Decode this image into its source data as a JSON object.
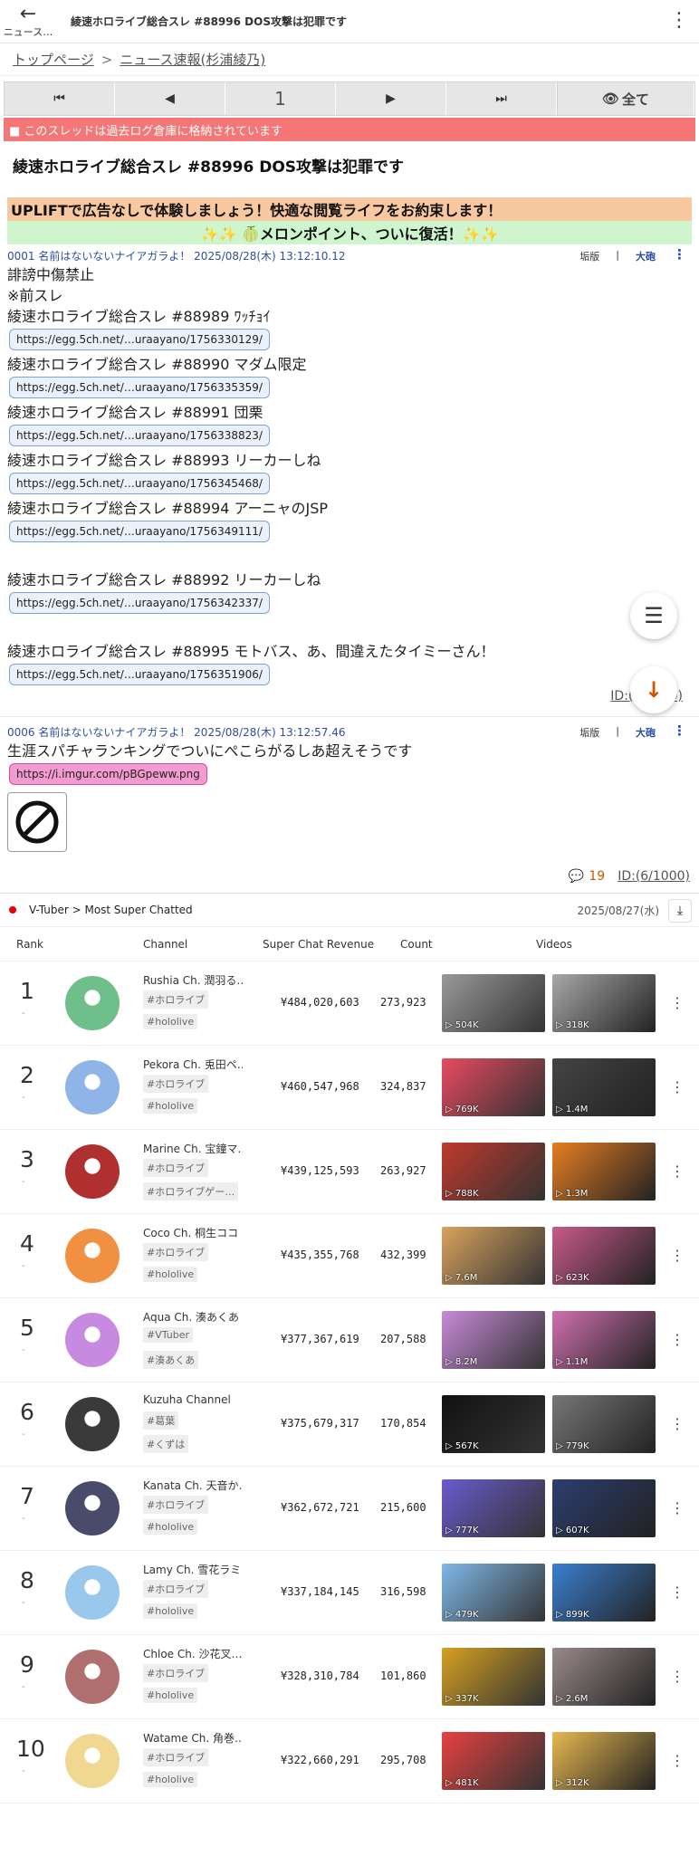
{
  "header": {
    "back_label": "ニュース…",
    "title": "綾速ホロライブ総合スレ #88996 DOS攻撃は犯罪です"
  },
  "breadcrumb": {
    "home": "トップページ",
    "sep": ">",
    "current": "ニュース速報(杉浦綾乃)"
  },
  "pager": {
    "page": "1",
    "all_label": "全て"
  },
  "archived_notice": "■ このスレッドは過去ログ倉庫に格納されています",
  "thread_title": "綾速ホロライブ総合スレ #88996 DOS攻撃は犯罪です",
  "ads": {
    "line1": "UPLIFTで広告なしで体験しましょう！快適な閲覧ライフをお約束します！",
    "line2": "✨✨ 🍈メロンポイント、ついに復活！✨✨"
  },
  "post1": {
    "header": "0001 名前はないないナイアガラよ！ 2025/08/28(木) 13:12:10.12",
    "meta_a": "垢版",
    "meta_sep": "|",
    "meta_b": "大砲",
    "intro1": "誹謗中傷禁止",
    "intro2": "※前スレ",
    "threads": [
      {
        "title": "綾速ホロライブ総合スレ #88989 ﾜｯﾁｮｲ",
        "url": "https://egg.5ch.net/…uraayano/1756330129/"
      },
      {
        "title": "綾速ホロライブ総合スレ #88990 マダム限定",
        "url": "https://egg.5ch.net/…uraayano/1756335359/"
      },
      {
        "title": "綾速ホロライブ総合スレ #88991 団栗",
        "url": "https://egg.5ch.net/…uraayano/1756338823/"
      },
      {
        "title": "綾速ホロライブ総合スレ #88993 リーカーしね",
        "url": "https://egg.5ch.net/…uraayano/1756345468/"
      },
      {
        "title": "綾速ホロライブ総合スレ #88994 アーニャのJSP",
        "url": "https://egg.5ch.net/…uraayano/1756349111/"
      }
    ],
    "extra": [
      {
        "title": "綾速ホロライブ総合スレ #88992 リーカーしね",
        "url": "https://egg.5ch.net/…uraayano/1756342337/"
      },
      {
        "title": "綾速ホロライブ総合スレ #88995 モトバス、あ、間違えたタイミーさん！",
        "url": "https://egg.5ch.net/…uraayano/1756351906/"
      }
    ],
    "id": "ID:(1/1000)"
  },
  "post6": {
    "header": "0006 名前はないないナイアガラよ！ 2025/08/28(木) 13:12:57.46",
    "meta_a": "垢版",
    "meta_sep": "|",
    "meta_b": "大砲",
    "text": "生涯スパチャランキングでついにぺこらがるしあ超えそうです",
    "url": "https://i.imgur.com/pBGpeww.png",
    "reply_count": "19",
    "id": "ID:(6/1000)"
  },
  "ranking": {
    "crumb": "V-Tuber > Most Super Chatted",
    "date": "2025/08/27(水)",
    "columns": {
      "rank": "Rank",
      "channel": "Channel",
      "revenue": "Super Chat Revenue",
      "count": "Count",
      "videos": "Videos"
    },
    "rows": [
      {
        "rank": "1",
        "diff": "-",
        "name": "Rushia Ch. 潤羽る…",
        "tags": [
          "#ホロライブ",
          "#hololive"
        ],
        "revenue": "¥484,020,603",
        "count": "273,923",
        "v1": "504K",
        "v2": "318K",
        "c1": "#999999",
        "c2": "#a8a8a8",
        "av": "#6fbf8a"
      },
      {
        "rank": "2",
        "diff": "-",
        "name": "Pekora Ch. 兎田ペ…",
        "tags": [
          "#ホロライブ",
          "#hololive"
        ],
        "revenue": "¥460,547,968",
        "count": "324,837",
        "v1": "769K",
        "v2": "1.4M",
        "c1": "#e84a5f",
        "c2": "#444444",
        "av": "#8fb4e8"
      },
      {
        "rank": "3",
        "diff": "-",
        "name": "Marine Ch. 宝鐘マ…",
        "tags": [
          "#ホロライブ",
          "#ホロライブゲー…"
        ],
        "revenue": "¥439,125,593",
        "count": "263,927",
        "v1": "788K",
        "v2": "1.3M",
        "c1": "#c0392b",
        "c2": "#e67e22",
        "av": "#b03030"
      },
      {
        "rank": "4",
        "diff": "-",
        "name": "Coco Ch. 桐生ココ",
        "tags": [
          "#ホロライブ",
          "#hololive"
        ],
        "revenue": "¥435,355,768",
        "count": "432,399",
        "v1": "7.6M",
        "v2": "623K",
        "c1": "#d9a25e",
        "c2": "#c85a8a",
        "av": "#f09040"
      },
      {
        "rank": "5",
        "diff": "-",
        "name": "Aqua Ch. 湊あくあ",
        "tags": [
          "#VTuber",
          "#湊あくあ"
        ],
        "revenue": "¥377,367,619",
        "count": "207,588",
        "v1": "8.2M",
        "v2": "1.1M",
        "c1": "#c88ad8",
        "c2": "#d070b0",
        "av": "#c68ae0"
      },
      {
        "rank": "6",
        "diff": "-",
        "name": "Kuzuha Channel",
        "tags": [
          "#葛葉",
          "#くずは"
        ],
        "revenue": "¥375,679,317",
        "count": "170,854",
        "v1": "567K",
        "v2": "779K",
        "c1": "#111111",
        "c2": "#777777",
        "av": "#3a3a3a"
      },
      {
        "rank": "7",
        "diff": "-",
        "name": "Kanata Ch. 天音か…",
        "tags": [
          "#ホロライブ",
          "#hololive"
        ],
        "revenue": "¥362,672,721",
        "count": "215,600",
        "v1": "777K",
        "v2": "607K",
        "c1": "#6a5acd",
        "c2": "#2c3e70",
        "av": "#4a4a6a"
      },
      {
        "rank": "8",
        "diff": "-",
        "name": "Lamy Ch. 雪花ラミィ",
        "tags": [
          "#ホロライブ",
          "#hololive"
        ],
        "revenue": "¥337,184,145",
        "count": "316,598",
        "v1": "479K",
        "v2": "899K",
        "c1": "#7fb8e8",
        "c2": "#3a7fd0",
        "av": "#9ac8ec"
      },
      {
        "rank": "9",
        "diff": "-",
        "name": "Chloe Ch. 沙花叉…",
        "tags": [
          "#ホロライブ",
          "#hololive"
        ],
        "revenue": "¥328,310,784",
        "count": "101,860",
        "v1": "337K",
        "v2": "2.6M",
        "c1": "#d4a020",
        "c2": "#9a8a8a",
        "av": "#b07070"
      },
      {
        "rank": "10",
        "diff": "-",
        "name": "Watame Ch. 角巻…",
        "tags": [
          "#ホロライブ",
          "#hololive"
        ],
        "revenue": "¥322,660,291",
        "count": "295,708",
        "v1": "481K",
        "v2": "312K",
        "c1": "#e84040",
        "c2": "#e8b850",
        "av": "#f0d890"
      }
    ]
  }
}
